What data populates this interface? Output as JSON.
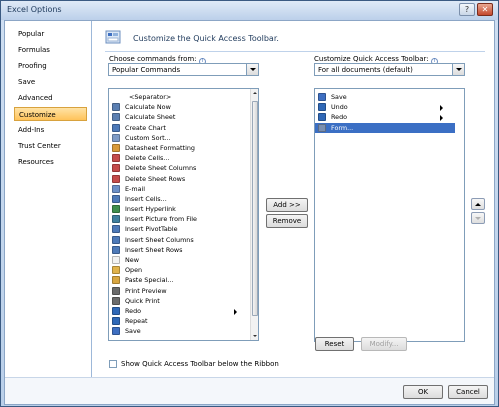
{
  "window": {
    "title": "Excel Options",
    "help_glyph": "?",
    "close_glyph": "✕"
  },
  "nav": {
    "items": [
      {
        "label": "Popular"
      },
      {
        "label": "Formulas"
      },
      {
        "label": "Proofing"
      },
      {
        "label": "Save"
      },
      {
        "label": "Advanced"
      },
      {
        "label": "Customize",
        "selected": true
      },
      {
        "label": "Add-Ins"
      },
      {
        "label": "Trust Center"
      },
      {
        "label": "Resources"
      }
    ]
  },
  "main": {
    "heading": "Customize the Quick Access Toolbar.",
    "choose_label": "Choose commands from:",
    "choose_value": "Popular Commands",
    "customize_label": "Customize Quick Access Toolbar:",
    "customize_value": "For all documents (default)",
    "info_glyph": "i",
    "commands": [
      {
        "label": "<Separator>",
        "icon": "separator",
        "separator": true
      },
      {
        "label": "Calculate Now",
        "icon": "calculate-now-icon"
      },
      {
        "label": "Calculate Sheet",
        "icon": "calculate-sheet-icon"
      },
      {
        "label": "Create Chart",
        "icon": "chart-icon"
      },
      {
        "label": "Custom Sort...",
        "icon": "sort-icon"
      },
      {
        "label": "Datasheet Formatting",
        "icon": "datasheet-icon"
      },
      {
        "label": "Delete Cells...",
        "icon": "delete-cells-icon"
      },
      {
        "label": "Delete Sheet Columns",
        "icon": "delete-columns-icon"
      },
      {
        "label": "Delete Sheet Rows",
        "icon": "delete-rows-icon"
      },
      {
        "label": "E-mail",
        "icon": "email-icon"
      },
      {
        "label": "Insert Cells...",
        "icon": "insert-cells-icon"
      },
      {
        "label": "Insert Hyperlink",
        "icon": "hyperlink-icon"
      },
      {
        "label": "Insert Picture from File",
        "icon": "picture-icon"
      },
      {
        "label": "Insert PivotTable",
        "icon": "pivot-icon"
      },
      {
        "label": "Insert Sheet Columns",
        "icon": "insert-columns-icon"
      },
      {
        "label": "Insert Sheet Rows",
        "icon": "insert-rows-icon"
      },
      {
        "label": "New",
        "icon": "new-icon"
      },
      {
        "label": "Open",
        "icon": "open-icon"
      },
      {
        "label": "Paste Special...",
        "icon": "paste-special-icon"
      },
      {
        "label": "Print Preview",
        "icon": "print-preview-icon"
      },
      {
        "label": "Quick Print",
        "icon": "quick-print-icon"
      },
      {
        "label": "Redo",
        "icon": "redo-icon",
        "submenu": true
      },
      {
        "label": "Repeat",
        "icon": "repeat-icon"
      },
      {
        "label": "Save",
        "icon": "save-icon"
      }
    ],
    "toolbar_items": [
      {
        "label": "Save",
        "icon": "save-icon"
      },
      {
        "label": "Undo",
        "icon": "undo-icon",
        "submenu": true
      },
      {
        "label": "Redo",
        "icon": "redo-icon",
        "submenu": true
      },
      {
        "label": "Form...",
        "icon": "form-icon",
        "selected": true
      }
    ],
    "add_button": "Add >>",
    "remove_button": "Remove",
    "reset_button": "Reset",
    "modify_button": "Modify...",
    "show_below_label": "Show Quick Access Toolbar below the Ribbon",
    "show_below_checked": false
  },
  "footer": {
    "ok": "OK",
    "cancel": "Cancel"
  },
  "colors": {
    "selection": "#3b6fc4",
    "nav_selected": "#ffc35a",
    "title_text": "#1e395b"
  }
}
